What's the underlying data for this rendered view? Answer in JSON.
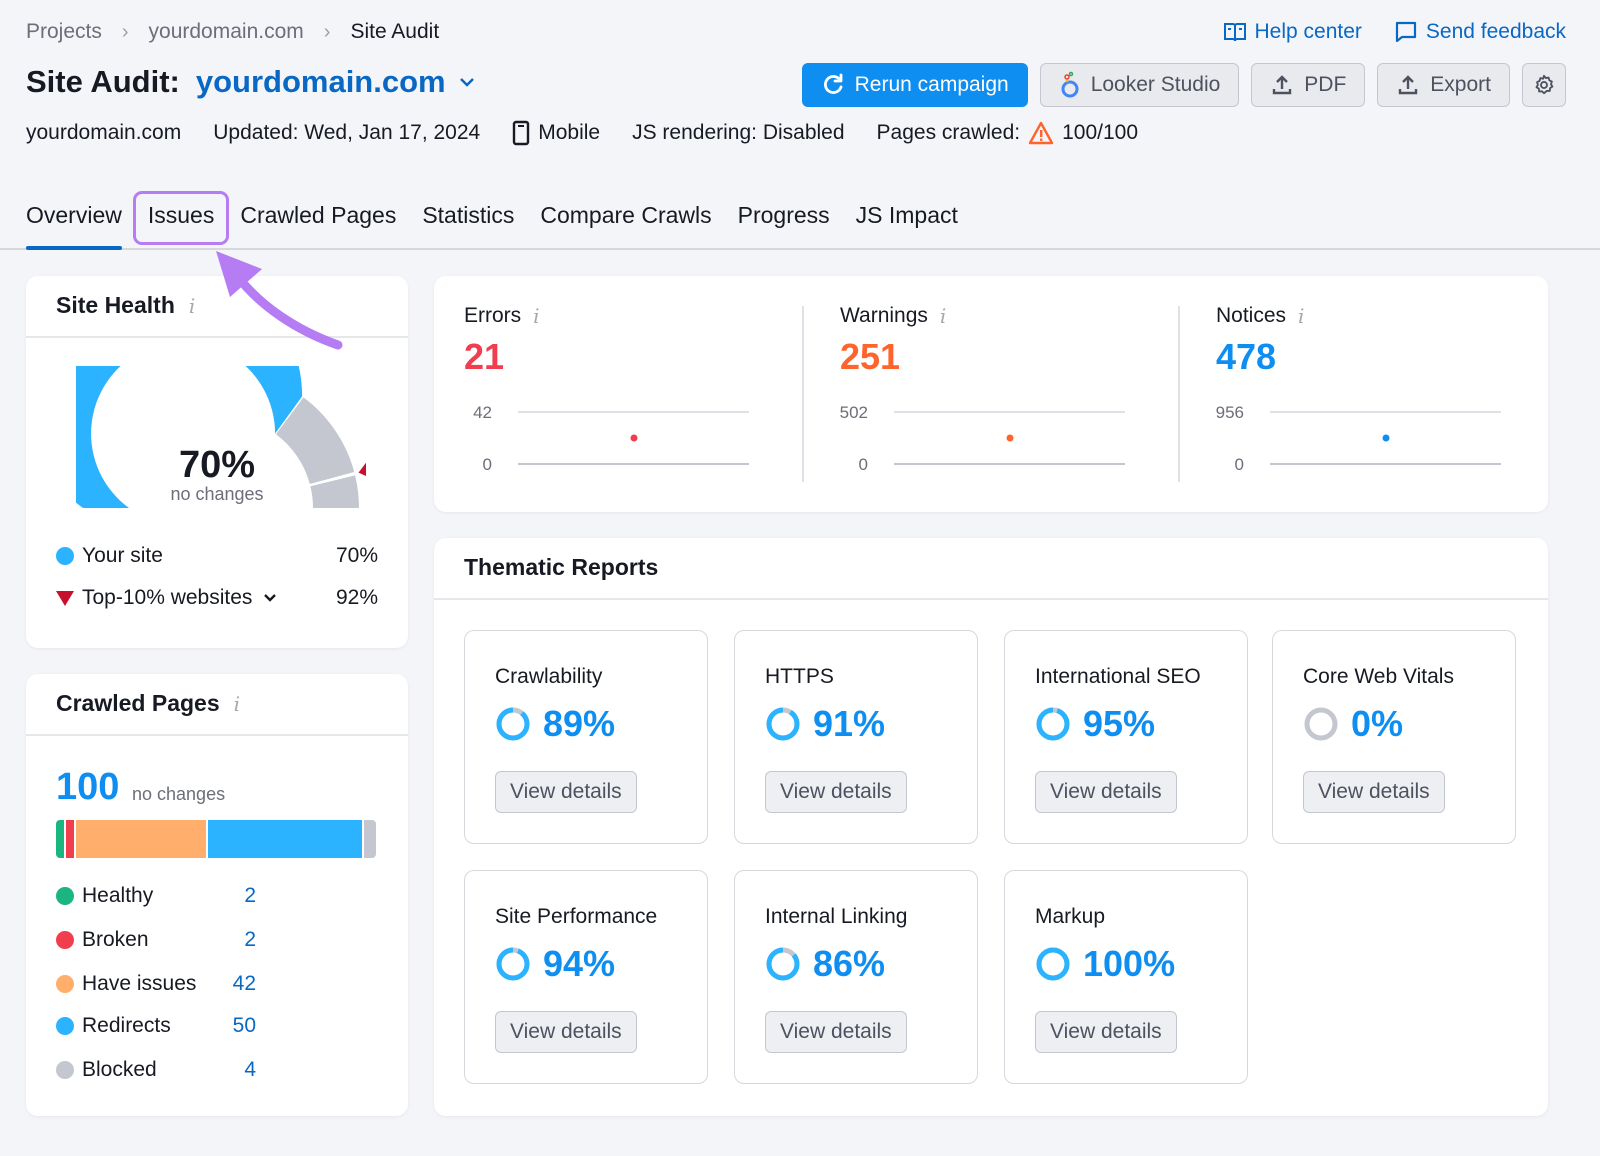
{
  "breadcrumb": [
    "Projects",
    "yourdomain.com",
    "Site Audit"
  ],
  "top_links": {
    "help": "Help center",
    "feedback": "Send feedback"
  },
  "title": {
    "label": "Site Audit:",
    "domain": "yourdomain.com"
  },
  "actions": {
    "rerun": "Rerun campaign",
    "looker": "Looker Studio",
    "pdf": "PDF",
    "export": "Export"
  },
  "meta": {
    "domain": "yourdomain.com",
    "updated": "Updated: Wed, Jan 17, 2024",
    "device": "Mobile",
    "js_rendering": "JS rendering: Disabled",
    "pages_crawled_label": "Pages crawled:",
    "pages_crawled_value": "100/100"
  },
  "tabs": [
    {
      "label": "Overview",
      "active": true
    },
    {
      "label": "Issues",
      "highlighted": true
    },
    {
      "label": "Crawled Pages"
    },
    {
      "label": "Statistics"
    },
    {
      "label": "Compare Crawls"
    },
    {
      "label": "Progress"
    },
    {
      "label": "JS Impact"
    }
  ],
  "site_health": {
    "title": "Site Health",
    "score_percent": 70,
    "score": "70%",
    "change": "no changes",
    "top10_percent": 92,
    "legend": [
      {
        "label": "Your site",
        "value": "70%",
        "color": "#2bb3ff"
      },
      {
        "label": "Top-10% websites",
        "value": "92%",
        "color": "#c8102e"
      }
    ]
  },
  "crawled_pages": {
    "title": "Crawled Pages",
    "total": "100",
    "change": "no changes",
    "items": [
      {
        "label": "Healthy",
        "value": 2,
        "color": "#1bb580"
      },
      {
        "label": "Broken",
        "value": 2,
        "color": "#f03e4e"
      },
      {
        "label": "Have issues",
        "value": 42,
        "color": "#ffae6b"
      },
      {
        "label": "Redirects",
        "value": 50,
        "color": "#2bb3ff"
      },
      {
        "label": "Blocked",
        "value": 4,
        "color": "#c4c7cf"
      }
    ]
  },
  "issues": [
    {
      "label": "Errors",
      "count": "21",
      "color": "#f03e4e",
      "axis_max": "42",
      "axis_min": "0",
      "value": 21,
      "max": 42
    },
    {
      "label": "Warnings",
      "count": "251",
      "color": "#ff642d",
      "axis_max": "502",
      "axis_min": "0",
      "value": 251,
      "max": 502
    },
    {
      "label": "Notices",
      "count": "478",
      "color": "#0f8ef2",
      "axis_max": "956",
      "axis_min": "0",
      "value": 478,
      "max": 956
    }
  ],
  "thematic": {
    "title": "Thematic Reports",
    "button_label": "View details",
    "reports": [
      {
        "name": "Crawlability",
        "score": "89%",
        "percent": 89
      },
      {
        "name": "HTTPS",
        "score": "91%",
        "percent": 91
      },
      {
        "name": "International SEO",
        "score": "95%",
        "percent": 95
      },
      {
        "name": "Core Web Vitals",
        "score": "0%",
        "percent": 0
      },
      {
        "name": "Site Performance",
        "score": "94%",
        "percent": 94
      },
      {
        "name": "Internal Linking",
        "score": "86%",
        "percent": 86
      },
      {
        "name": "Markup",
        "score": "100%",
        "percent": 100
      }
    ]
  }
}
